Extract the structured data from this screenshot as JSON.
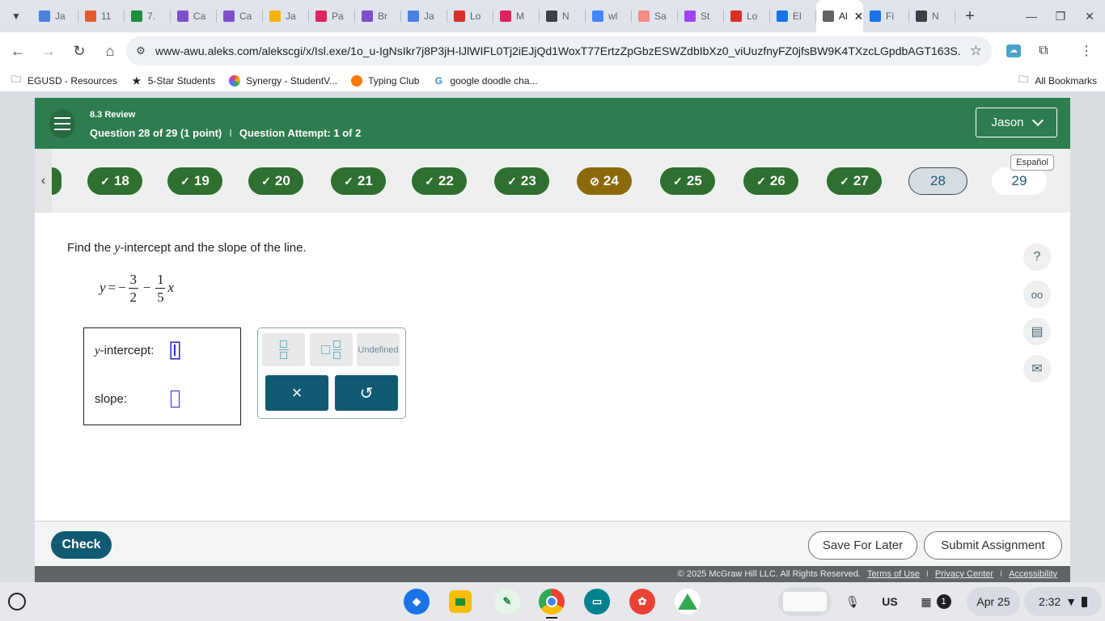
{
  "browser": {
    "tabs": [
      {
        "title": "Ja",
        "icon": "docs-icon",
        "color": "#4a7fe0"
      },
      {
        "title": "11",
        "icon": "slides-icon",
        "color": "#e25a2a"
      },
      {
        "title": "7.",
        "icon": "classroom-icon",
        "color": "#1e8e3e"
      },
      {
        "title": "Ca",
        "icon": "forms-icon",
        "color": "#7e4fc9"
      },
      {
        "title": "Ca",
        "icon": "forms-icon",
        "color": "#7e4fc9"
      },
      {
        "title": "Ja",
        "icon": "slides-icon",
        "color": "#f4b400"
      },
      {
        "title": "Pa",
        "icon": "newsela-icon",
        "color": "#e0245e"
      },
      {
        "title": "Br",
        "icon": "forms-icon",
        "color": "#7e4fc9"
      },
      {
        "title": "Ja",
        "icon": "docs-icon",
        "color": "#4a7fe0"
      },
      {
        "title": "Lo",
        "icon": "newsela-icon",
        "color": "#d93025"
      },
      {
        "title": "M",
        "icon": "newsela-icon",
        "color": "#e0245e"
      },
      {
        "title": "N",
        "icon": "chrome-icon",
        "color": "#3c4043"
      },
      {
        "title": "wl",
        "icon": "google-icon",
        "color": "#4285f4"
      },
      {
        "title": "Sa",
        "icon": "bookmark-icon",
        "color": "#f28b82"
      },
      {
        "title": "St",
        "icon": "synergy-icon",
        "color": "#a142f4"
      },
      {
        "title": "Lo",
        "icon": "newsela-icon",
        "color": "#d93025"
      },
      {
        "title": "El",
        "icon": "cloud-icon",
        "color": "#1a73e8"
      },
      {
        "title": "Al",
        "icon": "aleks-icon",
        "color": "#5f6368",
        "active": true
      },
      {
        "title": "Fi",
        "icon": "filo-icon",
        "color": "#1a73e8"
      },
      {
        "title": "N",
        "icon": "chrome-icon",
        "color": "#3c4043"
      }
    ],
    "url": "www-awu.aleks.com/alekscgi/x/Isl.exe/1o_u-IgNsIkr7j8P3jH-lJlWIFL0Tj2iEJjQd1WoxT77ErtzZpGbzESWZdbIbXz0_viUuzfnyFZ0jfsBW9K4TXzcLGpdbAGT163S...",
    "bookmarks": [
      {
        "label": "EGUSD - Resources",
        "icon": "folder-icon"
      },
      {
        "label": "5-Star Students",
        "icon": "star-logo-icon"
      },
      {
        "label": "Synergy - StudentV...",
        "icon": "synergy-icon"
      },
      {
        "label": "Typing Club",
        "icon": "typingclub-icon"
      },
      {
        "label": "google doodle cha...",
        "icon": "google-icon"
      }
    ],
    "all_bookmarks": "All Bookmarks"
  },
  "aleks": {
    "section": "8.3 Review",
    "question_label": "Question 28 of 29 (1 point)",
    "separator": "I",
    "attempt_label": "Question Attempt: 1 of 2",
    "user_name": "Jason",
    "espanol": "Español",
    "questions": [
      {
        "num": "18",
        "status": "correct"
      },
      {
        "num": "19",
        "status": "correct"
      },
      {
        "num": "20",
        "status": "correct"
      },
      {
        "num": "21",
        "status": "correct"
      },
      {
        "num": "22",
        "status": "correct"
      },
      {
        "num": "23",
        "status": "correct"
      },
      {
        "num": "24",
        "status": "partial"
      },
      {
        "num": "25",
        "status": "correct"
      },
      {
        "num": "26",
        "status": "correct"
      },
      {
        "num": "27",
        "status": "correct"
      },
      {
        "num": "28",
        "status": "current"
      },
      {
        "num": "29",
        "status": "upcoming"
      }
    ],
    "prompt": {
      "before": "Find the ",
      "var": "y",
      "after": "-intercept and the slope of the line."
    },
    "equation": {
      "lhs": "y",
      "eq": "=",
      "minus1": "−",
      "num1": "3",
      "den1": "2",
      "minus2": "−",
      "num2": "1",
      "den2": "5",
      "var": "x"
    },
    "answer": {
      "intercept_var": "y",
      "intercept_label": "-intercept:",
      "intercept_value": "",
      "slope_label": "slope:",
      "slope_value": ""
    },
    "palette": {
      "fraction": "fraction-icon",
      "mixed_number": "mixed-number-icon",
      "undefined_label": "Undefined",
      "clear": "×",
      "undo": "↺"
    },
    "footer": {
      "check": "Check",
      "save": "Save For Later",
      "submit": "Submit Assignment",
      "copyright": "© 2025 McGraw Hill LLC. All Rights Reserved.",
      "terms": "Terms of Use",
      "privacy": "Privacy Center",
      "accessibility": "Accessibility",
      "link_sep": "I"
    },
    "colors": {
      "header": "#2e7d4f",
      "correct": "#2f6f2f",
      "partial": "#8c6a0b",
      "primary_button": "#105a74"
    }
  },
  "shelf": {
    "locale": "US",
    "notifications": "1",
    "date": "Apr 25",
    "time": "2:32"
  }
}
